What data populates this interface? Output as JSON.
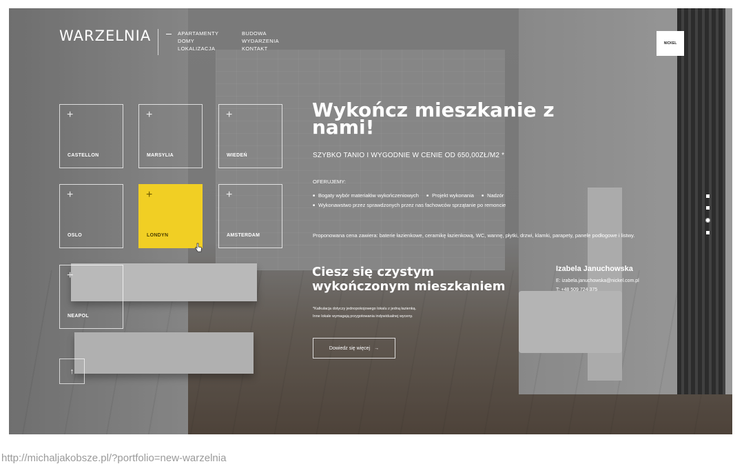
{
  "header": {
    "logo": "WARZELNIA",
    "nav_col1": [
      "APARTAMENTY",
      "DOMY",
      "LOKALIZACJA"
    ],
    "nav_col2": [
      "BUDOWA",
      "WYDARZENIA",
      "KONTAKT"
    ],
    "brand_badge": "NICKEL"
  },
  "tiles": [
    {
      "label": "CASTELLON",
      "plus": "+"
    },
    {
      "label": "MARSYLIA",
      "plus": "+"
    },
    {
      "label": "WIEDEŃ",
      "plus": "+"
    },
    {
      "label": "OSLO",
      "plus": "+"
    },
    {
      "label": "LONDYN",
      "plus": "+",
      "active": true
    },
    {
      "label": "AMSTERDAM",
      "plus": "+"
    },
    {
      "label": "NEAPOL",
      "plus": "+"
    }
  ],
  "active_color": "#f1cf24",
  "up_button": {
    "icon": "arrow-up-icon",
    "glyph": "↑"
  },
  "hero": {
    "headline": "Wykończ mieszkanie z nami!",
    "tagline": "SZYBKO TANIO I WYGODNIE W CENIE OD 650,00ZŁ/M2 *",
    "offer_label": "OFERUJEMY:",
    "offers": [
      "Bogaty wybór materiałów wykończeniowych",
      "Projekt wykonania",
      "Nadzór",
      "Wykonawstwo przez sprawdzonych przez nas fachowców sprzątanie po remoncie"
    ],
    "price_note": "Proponowana cena zawiera: baterie łazienkowe, ceramikę łazienkową, WC, wannę, płytki, drzwi, klamki, parapety, panele podłogowe i listwy.",
    "subhead": "Ciesz się czystym wykończonym mieszkaniem",
    "calc_note_1": "*Kalkulacja dotyczy jednopokojowego lokalu z jedną łazienką.",
    "calc_note_2": "Inne lokale wymagają przygotowania indywidualnej wyceny.",
    "more_button": "Dowiedz się więcej",
    "more_arrow": "→"
  },
  "contact": {
    "name": "Izabela Januchowska",
    "email": "E: izabela.januchowska@nickel.com.pl",
    "phone": "T: +48 509 724 375"
  },
  "slider_dots": {
    "count": 4,
    "active_index": 2
  },
  "caption_url": "http://michaljakobsze.pl/?portfolio=new-warzelnia"
}
